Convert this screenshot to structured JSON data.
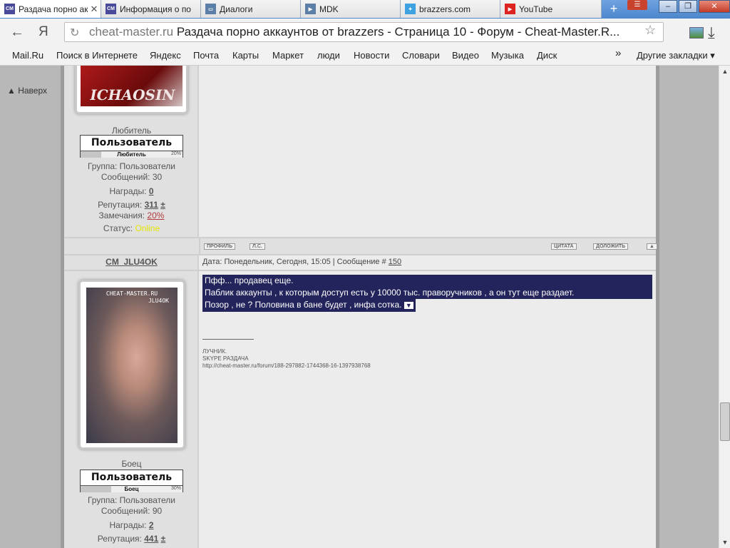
{
  "browser": {
    "tabs": [
      {
        "label": "Раздача порно акк",
        "favicon": "CM",
        "active": true
      },
      {
        "label": "Информация о по",
        "favicon": "CM",
        "active": false
      },
      {
        "label": "Диалоги",
        "favicon": "dialog-icon",
        "active": false
      },
      {
        "label": "MDK",
        "favicon": "play-icon",
        "active": false
      },
      {
        "label": "brazzers.com",
        "favicon": "twitter-icon",
        "active": false
      },
      {
        "label": "YouTube",
        "favicon": "youtube-icon",
        "active": false
      }
    ],
    "yandex_logo": "Я",
    "address": {
      "host": "cheat-master.ru",
      "separator": " ",
      "title": "Раздача порно аккаунтов от brazzers - Страница 10 - Форум - Cheat-Master.R..."
    },
    "bookmarks": [
      "Mail.Ru",
      "Поиск в Интернете",
      "Яндекс",
      "Почта",
      "Карты",
      "Маркет",
      "люди",
      "Новости",
      "Словари",
      "Видео",
      "Музыка",
      "Диск"
    ],
    "bookmarks_overflow": "»",
    "other_bookmarks": "Другие закладки ▾"
  },
  "page": {
    "back_to_top": "▲ Наверх",
    "post1": {
      "avatar_text": "ICHAOSIN",
      "rank_title": "Любитель",
      "rank_badge": "Пользователь",
      "rank_label": "Любитель",
      "rank_percent": "20%",
      "rank_fill": 0.2,
      "group": "Группа: Пользователи",
      "messages": "Сообщений: 30",
      "awards_label": "Награды: ",
      "awards_value": "0",
      "rep_label": "Репутация: ",
      "rep_value": "311",
      "rep_pm": "±",
      "warn_label": "Замечания: ",
      "warn_value": "20%",
      "status_label": "Статус: ",
      "status_value": "Online"
    },
    "post_buttons_left": [
      "ПРОФИЛЬ",
      "Л.С."
    ],
    "post_buttons_right": [
      "ЦИТАТА",
      "ДОЛОЖИТЬ",
      "▲"
    ],
    "post2": {
      "username": "CM_JLU4OK",
      "meta_prefix": "Дата: Понедельник, Сегодня, 15:05 | Сообщение # ",
      "meta_number": "150",
      "avatar_text": "CHEAT-MASTER.RU",
      "avatar_sub": "JLU4OK",
      "lines": [
        "Пфф... продавец еще.",
        "Паблик аккаунты , к которым доступ есть у 10000 тыс. праворучников , а он тут еще раздает.",
        "Позор , не ? Половина в бане будет , инфа сотка."
      ],
      "dropdown_glyph": "▼",
      "sig_lines": [
        "ЛУЧНИК.",
        "SKYPE РАЗДАЧА",
        "http://cheat-master.ru/forum/188-297882-1744368-16-1397938768"
      ],
      "rank_title": "Боец",
      "rank_badge": "Пользователь",
      "rank_label": "Боец",
      "rank_percent": "30%",
      "rank_fill": 0.3,
      "group": "Группа: Пользователи",
      "messages": "Сообщений: 90",
      "awards_label": "Награды: ",
      "awards_value": "2",
      "rep_label": "Репутация: ",
      "rep_value": "441",
      "rep_pm": "±"
    }
  },
  "colors": {
    "highlight": "#24245c",
    "online": "#e6e600",
    "warn": "#b23a3a"
  }
}
